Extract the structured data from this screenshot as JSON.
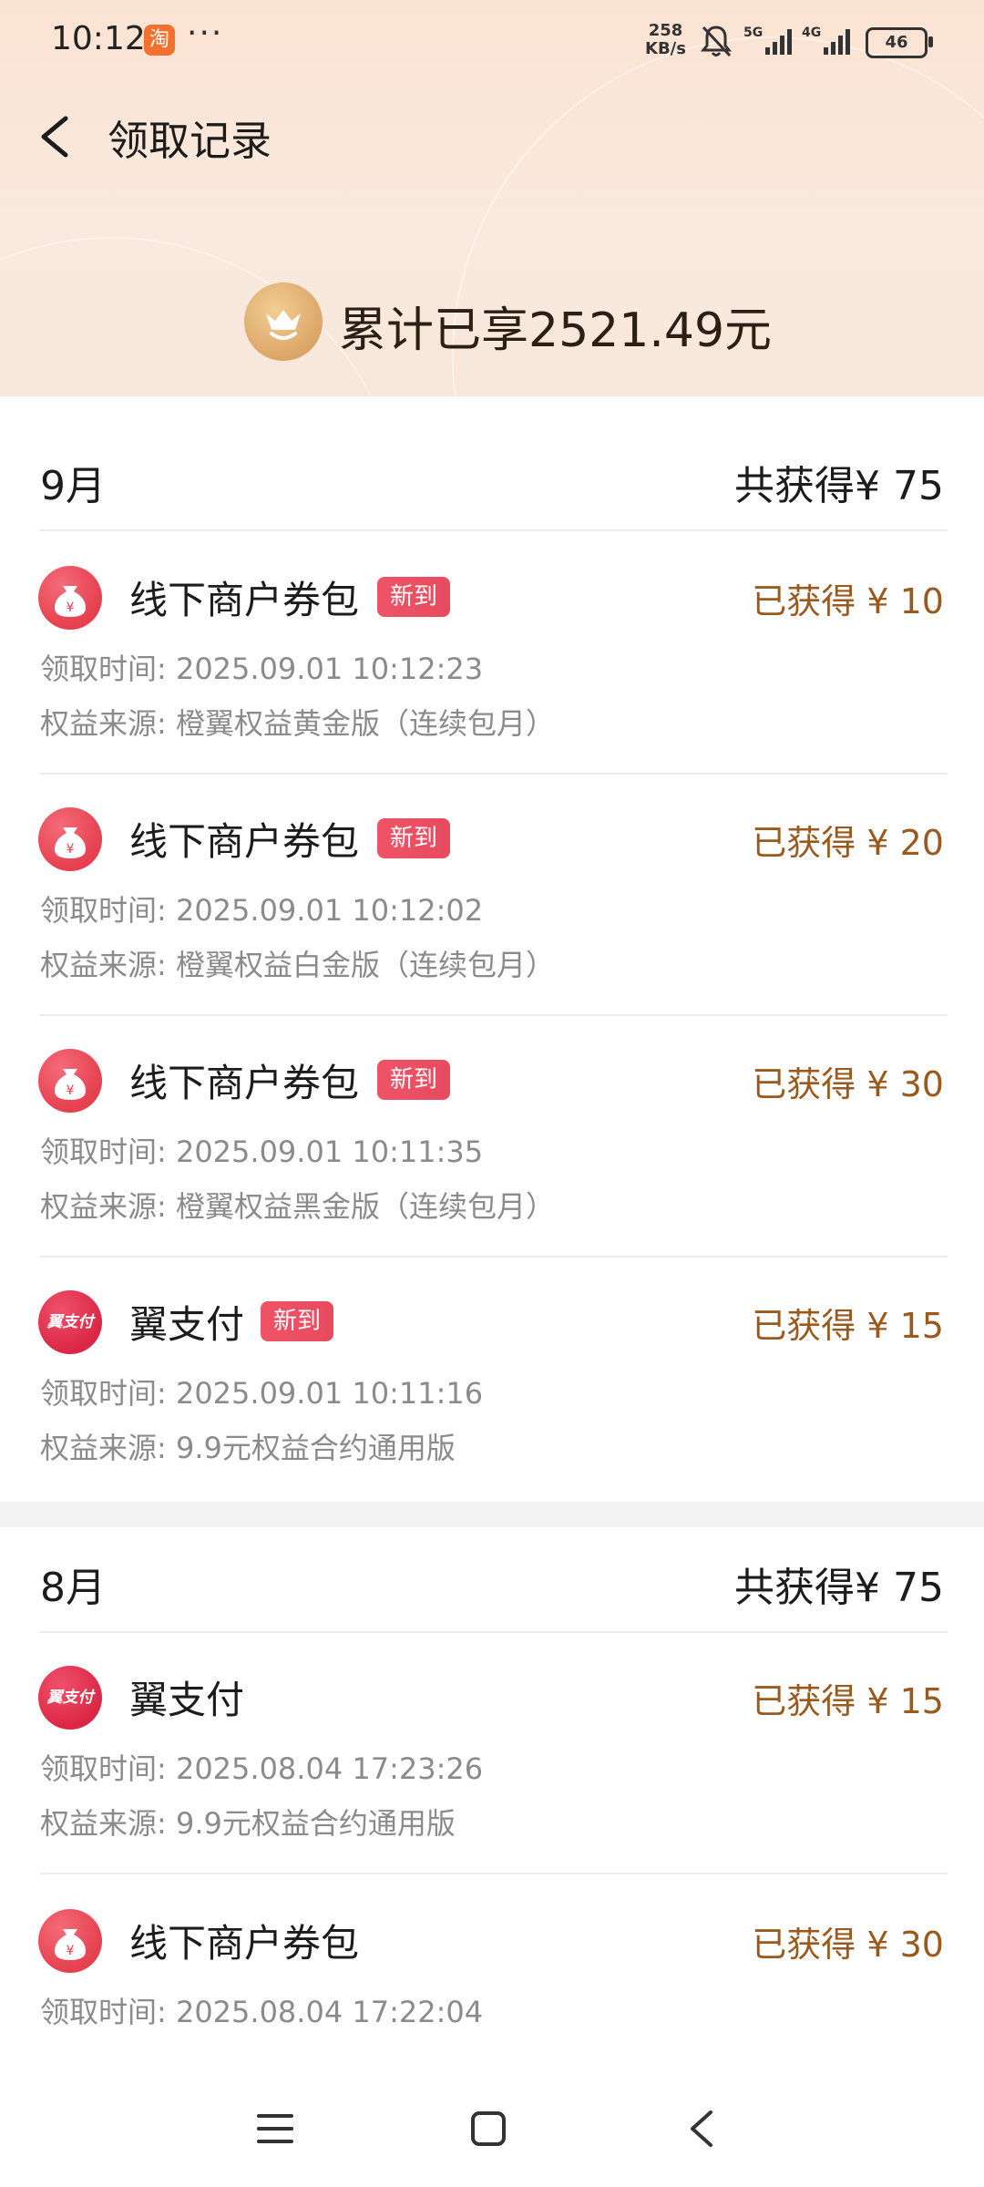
{
  "status_bar": {
    "time": "10:12",
    "app_badge": "淘",
    "more": "···",
    "speed_top": "258",
    "speed_bottom": "KB/s",
    "net1": "5G",
    "net2": "4G",
    "battery": "46"
  },
  "header": {
    "title": "领取记录"
  },
  "summary": {
    "text": "累计已享2521.49元"
  },
  "icons": {
    "back": "back-chevron-icon",
    "crown": "crown-basket-icon",
    "coupon": "money-bag-icon",
    "pay": "yi-pay-logo-icon"
  },
  "colors": {
    "amount": "#9a5a1e",
    "tag": "#e84a5e",
    "accent": "#dca667"
  },
  "months": [
    {
      "label": "9月",
      "total": "共获得¥ 75",
      "records": [
        {
          "name": "线下商户券包",
          "tag": "新到",
          "amount": "已获得 ¥ 10",
          "time": "领取时间: 2025.09.01 10:12:23",
          "source": "权益来源: 橙翼权益黄金版（连续包月）"
        },
        {
          "name": "线下商户券包",
          "tag": "新到",
          "amount": "已获得 ¥ 20",
          "time": "领取时间: 2025.09.01 10:12:02",
          "source": "权益来源: 橙翼权益白金版（连续包月）"
        },
        {
          "name": "线下商户券包",
          "tag": "新到",
          "amount": "已获得 ¥ 30",
          "time": "领取时间: 2025.09.01 10:11:35",
          "source": "权益来源: 橙翼权益黑金版（连续包月）"
        },
        {
          "name": "翼支付",
          "tag": "新到",
          "amount": "已获得 ¥ 15",
          "time": "领取时间: 2025.09.01 10:11:16",
          "source": "权益来源: 9.9元权益合约通用版",
          "logo": "翼支付"
        }
      ]
    },
    {
      "label": "8月",
      "total": "共获得¥ 75",
      "records": [
        {
          "name": "翼支付",
          "amount": "已获得 ¥ 15",
          "time": "领取时间: 2025.08.04 17:23:26",
          "source": "权益来源: 9.9元权益合约通用版",
          "logo": "翼支付"
        },
        {
          "name": "线下商户券包",
          "amount": "已获得 ¥ 30",
          "time": "领取时间: 2025.08.04 17:22:04"
        }
      ]
    }
  ]
}
